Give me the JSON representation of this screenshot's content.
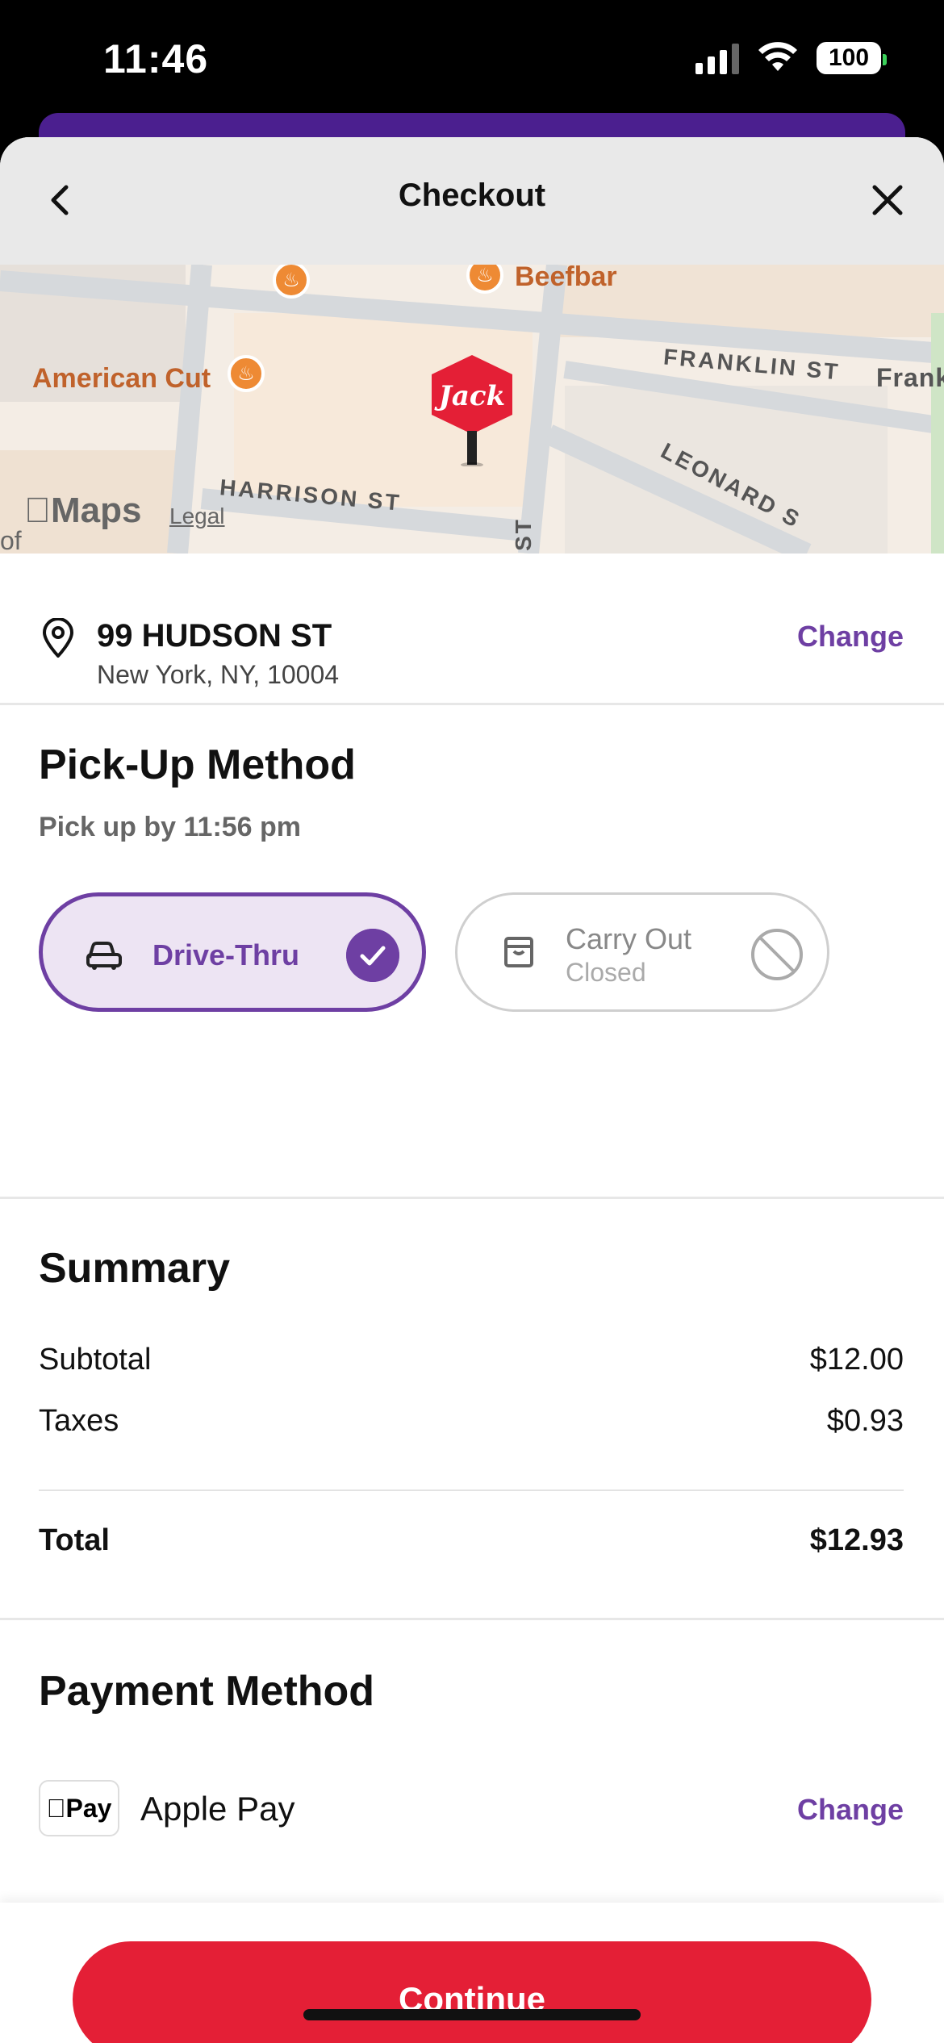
{
  "status_bar": {
    "time": "11:46",
    "battery": "100"
  },
  "header": {
    "title": "Checkout"
  },
  "map": {
    "streets": [
      "FRANKLIN ST",
      "Frank",
      "HARRISON ST",
      "LEONARD S",
      "ST"
    ],
    "pois": [
      {
        "name": "Beefbar"
      },
      {
        "name": "American Cut"
      }
    ],
    "brand_pin": "Jack",
    "attribution": "Maps",
    "legal": "Legal",
    "edge_text": "of"
  },
  "address": {
    "line1": "99 HUDSON ST",
    "line2": "New York, NY, 10004",
    "change_label": "Change"
  },
  "pickup": {
    "title": "Pick-Up Method",
    "subtitle": "Pick up by 11:56 pm",
    "options": [
      {
        "label": "Drive-Thru",
        "selected": true
      },
      {
        "label": "Carry Out",
        "status": "Closed",
        "selected": false
      }
    ]
  },
  "summary": {
    "title": "Summary",
    "subtotal_label": "Subtotal",
    "subtotal_value": "$12.00",
    "taxes_label": "Taxes",
    "taxes_value": "$0.93",
    "total_label": "Total",
    "total_value": "$12.93"
  },
  "payment": {
    "title": "Payment Method",
    "badge": "Pay",
    "method": "Apple Pay",
    "change_label": "Change"
  },
  "footer": {
    "continue_label": "Continue"
  },
  "colors": {
    "accent_purple": "#6e3fa3",
    "continue_red": "#e41f36",
    "poi_orange": "#ee8a34"
  }
}
